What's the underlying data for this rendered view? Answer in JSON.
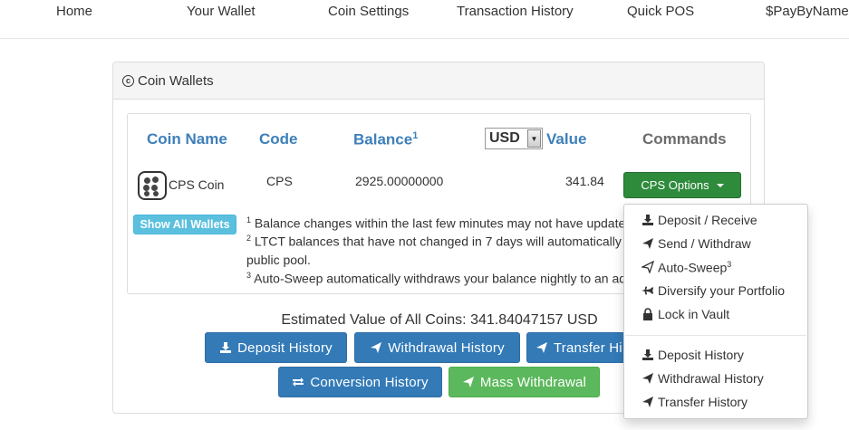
{
  "nav": [
    "Home",
    "Your Wallet",
    "Coin Settings",
    "Transaction History",
    "Quick POS",
    "$PayByName"
  ],
  "panel": {
    "title": "Coin Wallets"
  },
  "table": {
    "headers": {
      "name": "Coin Name",
      "code": "Code",
      "balance": "Balance",
      "balance_sup": "1",
      "value": "Value",
      "commands": "Commands"
    },
    "currency_select": "USD",
    "row": {
      "name": "CPS Coin",
      "code": "CPS",
      "balance": "2925.00000000",
      "value": "341.84",
      "options_label": "CPS Options"
    }
  },
  "show_all_wallets": "Show All Wallets",
  "notes": [
    {
      "sup": "1",
      "text": "Balance changes within the last few minutes may not have updated"
    },
    {
      "sup": "2",
      "text": "LTCT balances that have not changed in 7 days will automatically be"
    },
    {
      "sup": "",
      "text": "public pool."
    },
    {
      "sup": "3",
      "text": "Auto-Sweep automatically withdraws your balance nightly to an ad"
    }
  ],
  "estimated": "Estimated Value of All Coins: 341.84047157 USD",
  "history_buttons": {
    "deposit": "Deposit History",
    "withdrawal": "Withdrawal History",
    "transfer": "Transfer Hi",
    "conversion": "Conversion History",
    "mass": "Mass Withdrawal"
  },
  "dropdown": {
    "deposit_receive": "Deposit / Receive",
    "send_withdraw": "Send / Withdraw",
    "auto_sweep": "Auto-Sweep",
    "auto_sweep_sup": "3",
    "diversify": "Diversify your Portfolio",
    "lock_vault": "Lock in Vault",
    "deposit_history": "Deposit History",
    "withdrawal_history": "Withdrawal History",
    "transfer_history": "Transfer History"
  },
  "colors": {
    "link_blue": "#3e7fb9",
    "primary": "#337ab7",
    "success": "#5cb85c",
    "options_green": "#2e8b3c",
    "info": "#5bc0de"
  }
}
